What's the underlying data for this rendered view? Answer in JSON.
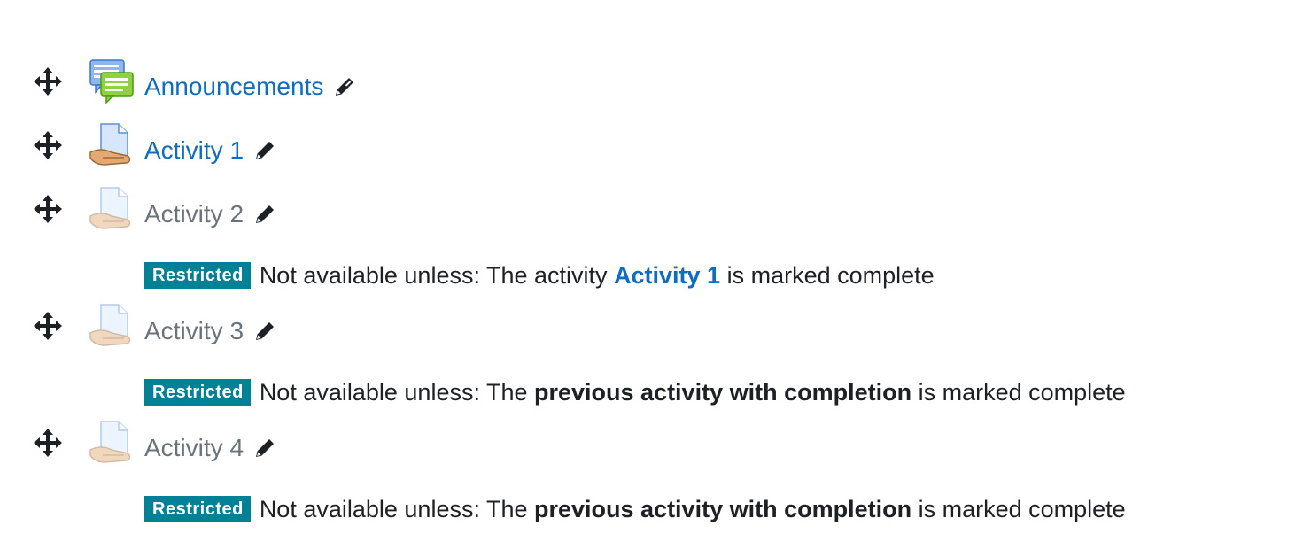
{
  "activities": [
    {
      "title": "Announcements",
      "icon": "forum-icon",
      "available": true
    },
    {
      "title": "Activity 1",
      "icon": "assignment-icon",
      "available": true
    },
    {
      "title": "Activity 2",
      "icon": "assignment-icon",
      "available": false,
      "restriction": {
        "badge": "Restricted",
        "prefix": "Not available unless: The activity ",
        "link": "Activity 1",
        "suffix": " is marked complete"
      }
    },
    {
      "title": "Activity 3",
      "icon": "assignment-icon",
      "available": false,
      "restriction": {
        "badge": "Restricted",
        "prefix": "Not available unless: The ",
        "bold": "previous activity with completion",
        "suffix": " is marked complete"
      }
    },
    {
      "title": "Activity 4",
      "icon": "assignment-icon",
      "available": false,
      "restriction": {
        "badge": "Restricted",
        "prefix": "Not available unless: The ",
        "bold": "previous activity with completion",
        "suffix": " is marked complete"
      }
    }
  ],
  "colors": {
    "link": "#0f6cbf",
    "dimmed_text": "#6a737b",
    "badge_bg": "#008196",
    "text": "#1d2125"
  }
}
